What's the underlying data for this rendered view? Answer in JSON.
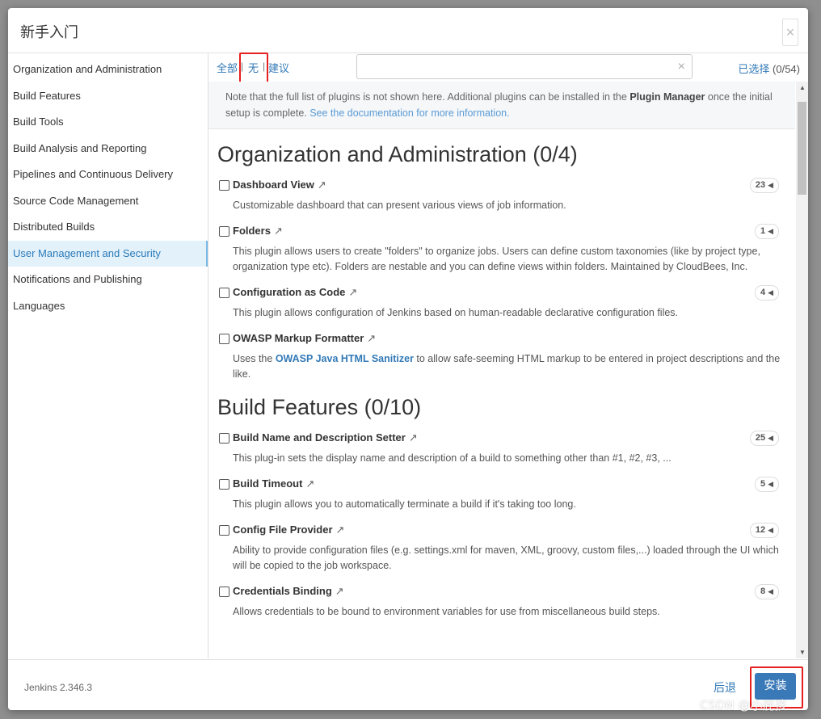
{
  "dialog": {
    "title": "新手入门",
    "close": "×"
  },
  "sidebar": {
    "items": [
      {
        "label": "Organization and Administration"
      },
      {
        "label": "Build Features"
      },
      {
        "label": "Build Tools"
      },
      {
        "label": "Build Analysis and Reporting"
      },
      {
        "label": "Pipelines and Continuous Delivery"
      },
      {
        "label": "Source Code Management"
      },
      {
        "label": "Distributed Builds"
      },
      {
        "label": "User Management and Security"
      },
      {
        "label": "Notifications and Publishing"
      },
      {
        "label": "Languages"
      }
    ]
  },
  "toolbar": {
    "all": "全部",
    "none": "无",
    "suggested": "建议",
    "separator": "|",
    "search_value": "",
    "clear": "×",
    "selected_label": "已选择",
    "selected_count": "(0/54)"
  },
  "note": {
    "text1": "Note that the full list of plugins is not shown here. Additional plugins can be installed in the ",
    "bold": "Plugin Manager",
    "text2": " once the initial setup is complete. ",
    "link": "See the documentation for more information."
  },
  "categories": [
    {
      "title": "Organization and Administration (0/4)",
      "plugins": [
        {
          "name": "Dashboard View",
          "count": "23",
          "desc": "Customizable dashboard that can present various views of job information."
        },
        {
          "name": "Folders",
          "count": "1",
          "desc": "This plugin allows users to create \"folders\" to organize jobs. Users can define custom taxonomies (like by project type, organization type etc). Folders are nestable and you can define views within folders. Maintained by CloudBees, Inc."
        },
        {
          "name": "Configuration as Code",
          "count": "4",
          "desc": "This plugin allows configuration of Jenkins based on human-readable declarative configuration files."
        },
        {
          "name": "OWASP Markup Formatter",
          "count": "",
          "desc_pre": "Uses the ",
          "desc_link": "OWASP Java HTML Sanitizer",
          "desc_post": " to allow safe-seeming HTML markup to be entered in project descriptions and the like."
        }
      ]
    },
    {
      "title": "Build Features (0/10)",
      "plugins": [
        {
          "name": "Build Name and Description Setter",
          "count": "25",
          "desc": "This plug-in sets the display name and description of a build to something other than #1, #2, #3, ..."
        },
        {
          "name": "Build Timeout",
          "count": "5",
          "desc": "This plugin allows you to automatically terminate a build if it's taking too long."
        },
        {
          "name": "Config File Provider",
          "count": "12",
          "desc": "Ability to provide configuration files (e.g. settings.xml for maven, XML, groovy, custom files,...) loaded through the UI which will be copied to the job workspace."
        },
        {
          "name": "Credentials Binding",
          "count": "8",
          "desc": "Allows credentials to be bound to environment variables for use from miscellaneous build steps."
        }
      ]
    }
  ],
  "footer": {
    "version": "Jenkins 2.346.3",
    "back": "后退",
    "install": "安装"
  },
  "watermark": "CSDN @小屁孩",
  "colors": {
    "accent": "#337ab7",
    "highlight_box": "#e62020",
    "install_bg": "#3a79b8"
  }
}
